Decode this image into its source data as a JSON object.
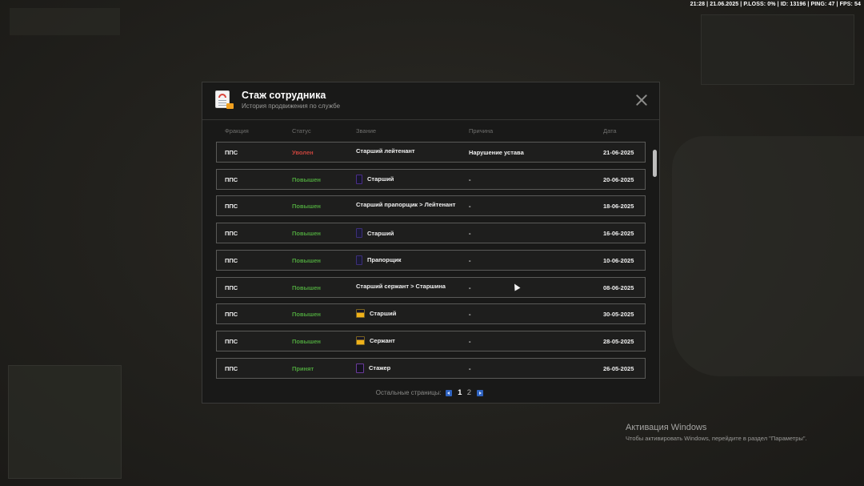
{
  "status_bar": "21:28 | 21.06.2025 | P.LOSS: 0% | ID: 13196 | PING: 47 | FPS: 54",
  "modal": {
    "title": "Стаж сотрудника",
    "subtitle": "История продвижения по службе",
    "icon": "document-icon",
    "close_icon": "close-icon"
  },
  "columns": {
    "faction": "Фракция",
    "status": "Статус",
    "rank": "Звание",
    "reason": "Причина",
    "date": "Дата"
  },
  "rows": [
    {
      "faction": "ППС",
      "status": "Уволен",
      "status_color": "#c8443d",
      "rank": "Старший лейтенант",
      "rank_icon": "",
      "reason": "Нарушение устава",
      "date": "21-06-2025"
    },
    {
      "faction": "ППС",
      "status": "Повышен",
      "status_color": "#4ea33d",
      "rank": "Старший",
      "rank_icon": "purple-stripe-icon",
      "reason": "-",
      "date": "20-06-2025"
    },
    {
      "faction": "ППС",
      "status": "Повышен",
      "status_color": "#4ea33d",
      "rank": "Старший прапорщик > Лейтенант",
      "rank_icon": "",
      "reason": "-",
      "date": "18-06-2025"
    },
    {
      "faction": "ППС",
      "status": "Повышен",
      "status_color": "#4ea33d",
      "rank": "Старший",
      "rank_icon": "purple-dot-icon",
      "reason": "-",
      "date": "16-06-2025"
    },
    {
      "faction": "ППС",
      "status": "Повышен",
      "status_color": "#4ea33d",
      "rank": "Прапорщик",
      "rank_icon": "purple-dot-icon",
      "reason": "-",
      "date": "10-06-2025"
    },
    {
      "faction": "ППС",
      "status": "Повышен",
      "status_color": "#4ea33d",
      "rank": "Старший сержант > Старшина",
      "rank_icon": "",
      "reason": "-",
      "date": "08-06-2025"
    },
    {
      "faction": "ППС",
      "status": "Повышен",
      "status_color": "#4ea33d",
      "rank": "Старший",
      "rank_icon": "gold-stripe-icon",
      "reason": "-",
      "date": "30-05-2025"
    },
    {
      "faction": "ППС",
      "status": "Повышен",
      "status_color": "#4ea33d",
      "rank": "Сержант",
      "rank_icon": "gold-stripe-icon",
      "reason": "-",
      "date": "28-05-2025"
    },
    {
      "faction": "ППС",
      "status": "Принят",
      "status_color": "#4ea33d",
      "rank": "Стажер",
      "rank_icon": "trainee-icon",
      "reason": "-",
      "date": "26-05-2025"
    }
  ],
  "pager": {
    "label": "Остальные страницы:",
    "current": "1",
    "pages": [
      "1",
      "2"
    ]
  },
  "windows_activation": {
    "title": "Активация Windows",
    "subtitle": "Чтобы активировать Windows, перейдите в раздел \"Параметры\"."
  }
}
